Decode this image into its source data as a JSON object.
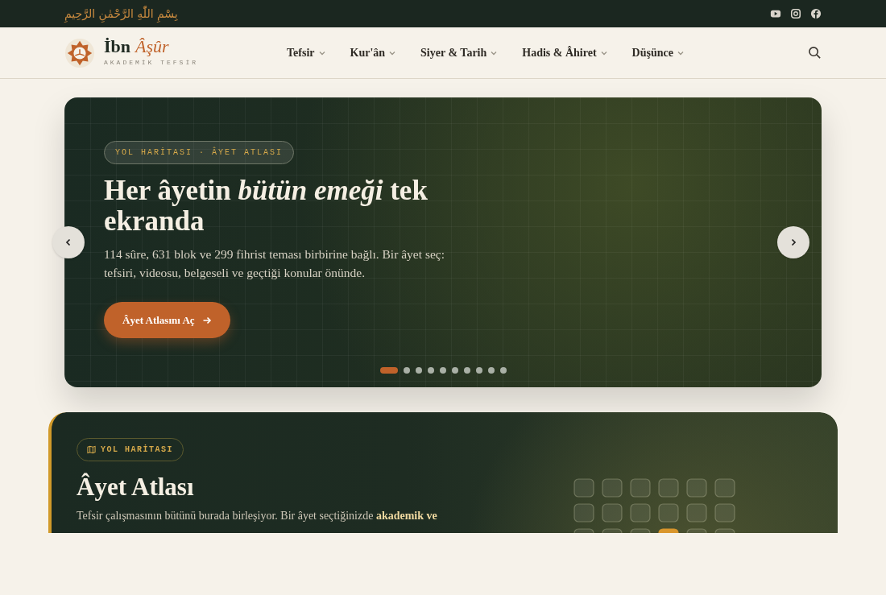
{
  "top_bar": {
    "basmala": "بِسْمِ اللّٰهِ الرَّحْمٰنِ الرَّحِيمِ",
    "social": [
      {
        "kind": "youtube"
      },
      {
        "kind": "instagram"
      },
      {
        "kind": "facebook"
      }
    ]
  },
  "header": {
    "logo_name": "İbn",
    "logo_accent": "Âşûr",
    "logo_tagline": "AKADEMİK TEFSİR",
    "nav": [
      {
        "label": "Tefsir"
      },
      {
        "label": "Kur'ân"
      },
      {
        "label": "Siyer & Tarih"
      },
      {
        "label": "Hadis & Âhiret"
      },
      {
        "label": "Düşünce"
      }
    ]
  },
  "hero": {
    "badge": "YOL HARİTASI · ÂYET ATLASI",
    "title": "Her âyetin *bütün emeği* tek ekranda",
    "text": "114 sûre, 631 blok ve 299 fihrist teması birbirine bağlı. Bir âyet seç: tefsiri, videosu, belgeseli ve geçtiği konular önünde.",
    "button": "Âyet Atlasını Aç",
    "dots": [
      {
        "selected": true
      },
      {
        "selected": false
      },
      {
        "selected": false
      },
      {
        "selected": false
      },
      {
        "selected": false
      },
      {
        "selected": false
      },
      {
        "selected": false
      },
      {
        "selected": false
      },
      {
        "selected": false
      },
      {
        "selected": false
      }
    ]
  },
  "atlas": {
    "badge": "YOL HARİTASI",
    "title": "Âyet Atlası",
    "text": "Tefsir çalışmasının bütünü burada birleşiyor. Bir âyet seçtiğinizde **akademik ve**"
  }
}
